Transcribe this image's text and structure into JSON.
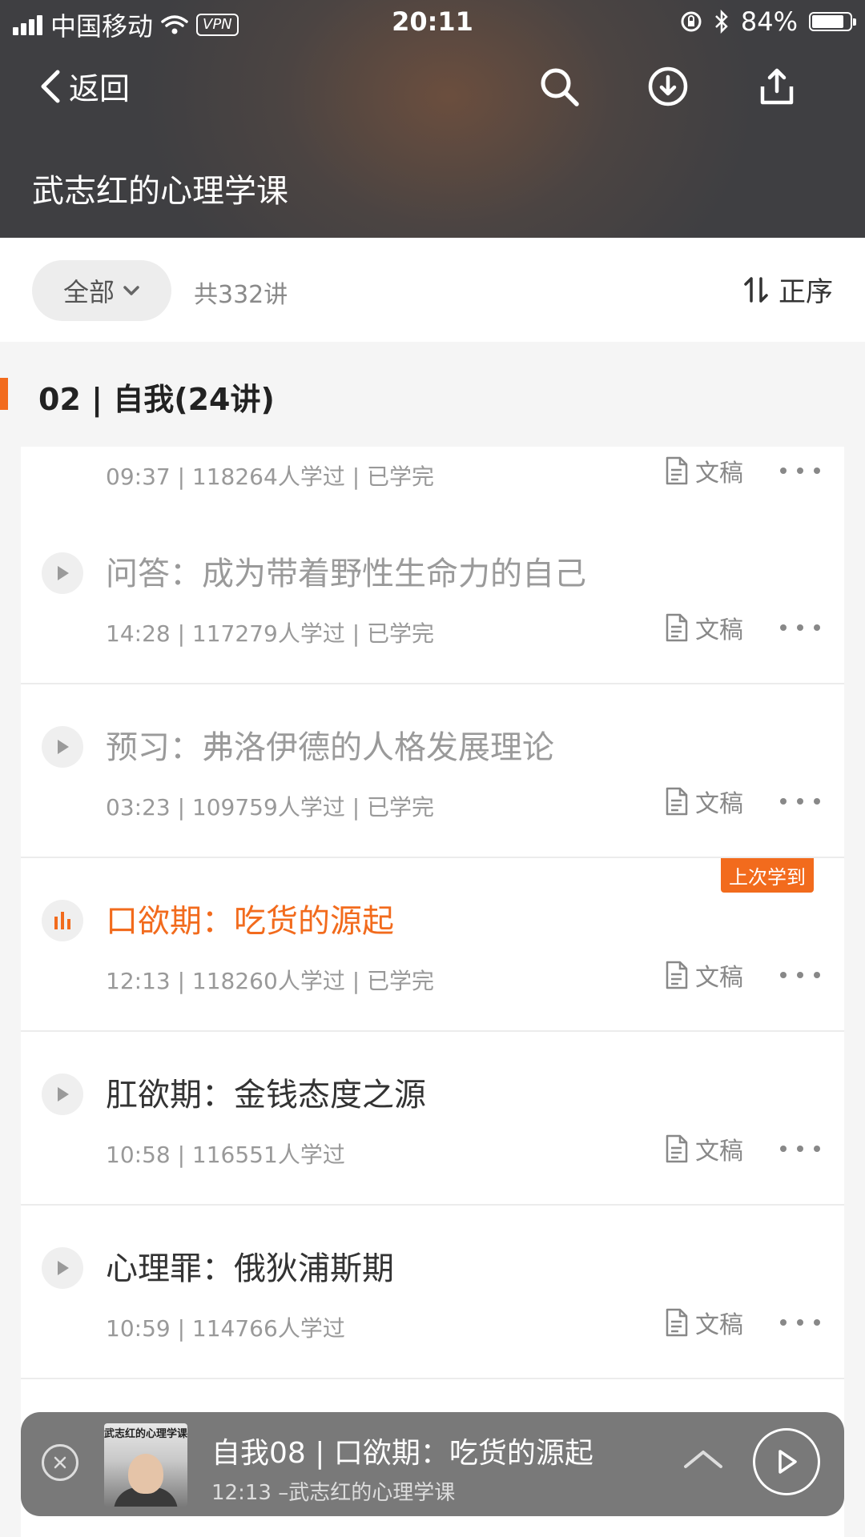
{
  "status_bar": {
    "carrier": "中国移动",
    "vpn": "VPN",
    "time": "20:11",
    "battery": "84%",
    "battery_level": 0.84
  },
  "nav": {
    "back_label": "返回",
    "title": "武志红的心理学课",
    "icons": [
      "search-icon",
      "download-icon",
      "share-icon"
    ]
  },
  "filter": {
    "selected": "全部",
    "count_label": "共332讲",
    "sort_label": "正序"
  },
  "section": {
    "title": "02 | 自我(24讲)"
  },
  "lessons": [
    {
      "title": "",
      "meta": "09:37 | 118264人学过 | 已学完",
      "doc_label": "文稿",
      "state": "done"
    },
    {
      "title": "问答：成为带着野性生命力的自己",
      "meta": "14:28 | 117279人学过 | 已学完",
      "doc_label": "文稿",
      "state": "done"
    },
    {
      "title": "预习：弗洛伊德的人格发展理论",
      "meta": "03:23 | 109759人学过 | 已学完",
      "doc_label": "文稿",
      "state": "done"
    },
    {
      "title": "口欲期：吃货的源起",
      "meta": "12:13 | 118260人学过 | 已学完",
      "doc_label": "文稿",
      "state": "active",
      "badge": "上次学到"
    },
    {
      "title": "肛欲期：金钱态度之源",
      "meta": "10:58 | 116551人学过",
      "doc_label": "文稿",
      "state": "normal"
    },
    {
      "title": "心理罪：俄狄浦斯期",
      "meta": "10:59 | 114766人学过",
      "doc_label": "文稿",
      "state": "normal"
    }
  ],
  "player": {
    "cover_title": "武志红的心理学课",
    "title": "自我08 | 口欲期：吃货的源起",
    "subtitle": "12:13  –武志红的心理学课"
  },
  "colors": {
    "accent": "#f26b1d",
    "header_bg": "#4b4442"
  }
}
